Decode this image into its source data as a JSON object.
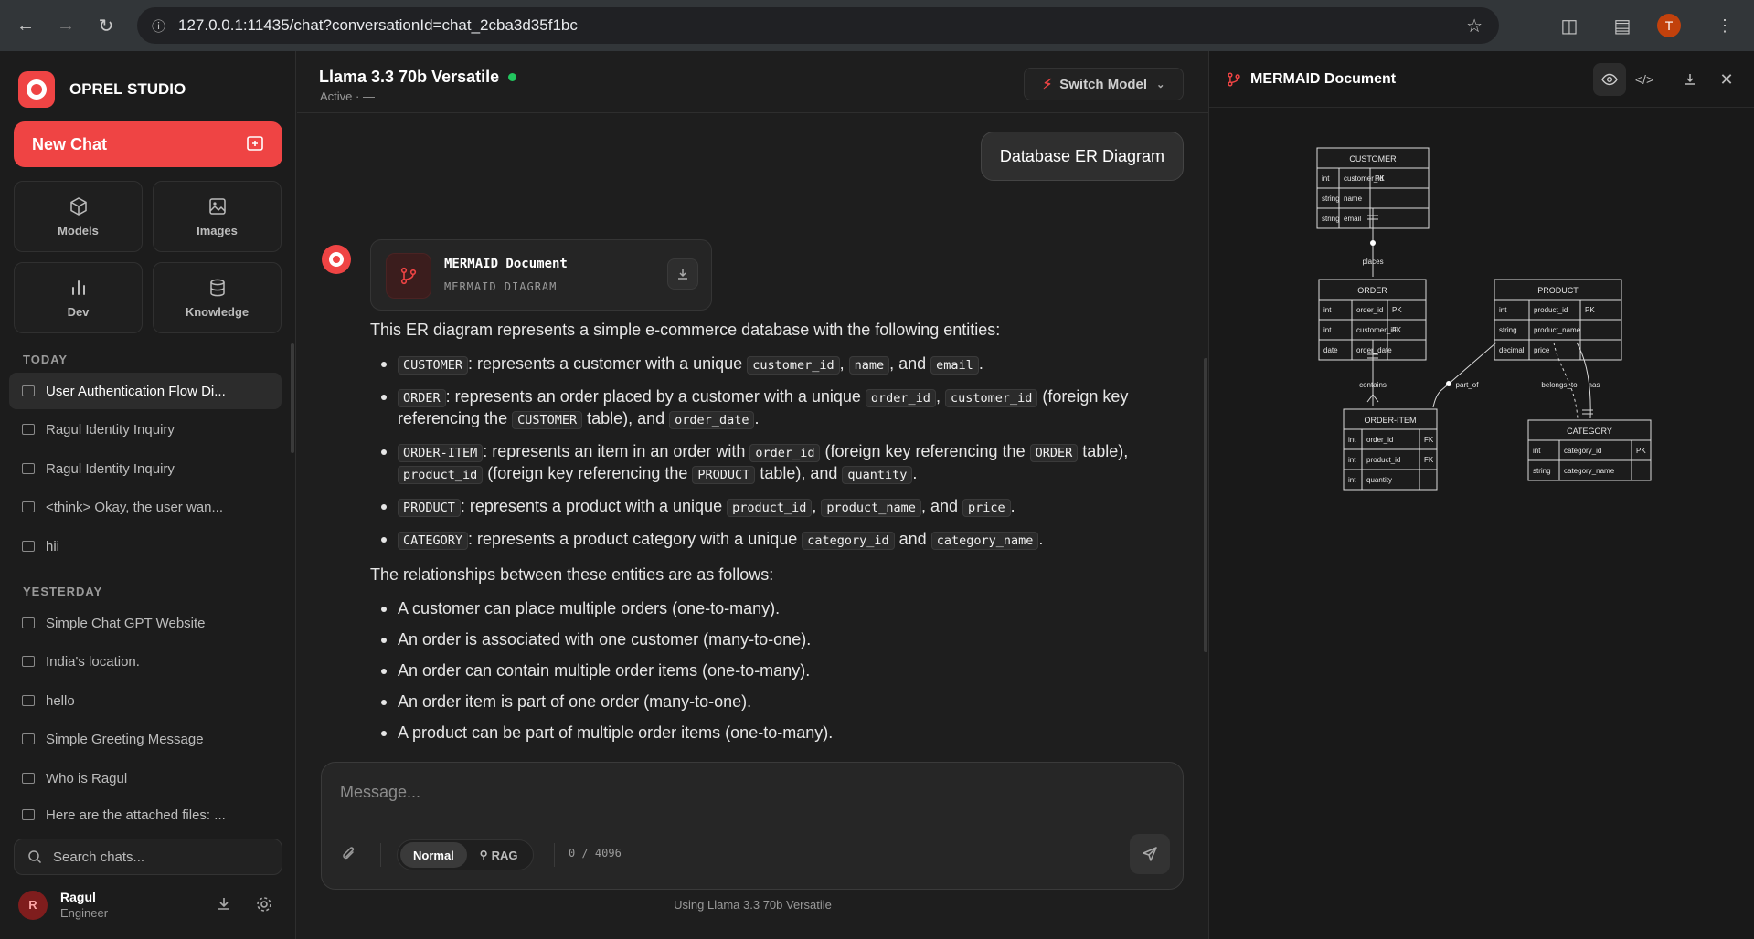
{
  "browser": {
    "url": "127.0.0.1:11435/chat?conversationId=chat_2cba3d35f1bc",
    "profile_initial": "T"
  },
  "sidebar": {
    "brand": "OPREL STUDIO",
    "new_chat": "New Chat",
    "tiles": [
      "Models",
      "Images",
      "Dev",
      "Knowledge"
    ],
    "today_label": "TODAY",
    "today": [
      "User Authentication Flow Di...",
      "Ragul Identity Inquiry",
      "Ragul Identity Inquiry",
      "<think> Okay, the user wan...",
      "hii"
    ],
    "yesterday_label": "YESTERDAY",
    "yesterday": [
      "Simple Chat GPT Website",
      "India's location.",
      "hello",
      "Simple Greeting Message",
      "Who is Ragul",
      "Here are the attached files: ..."
    ],
    "search_placeholder": "Search chats...",
    "user": {
      "initial": "R",
      "name": "Ragul",
      "role": "Engineer"
    }
  },
  "chat": {
    "model_name": "Llama 3.3 70b Versatile",
    "status": "Active · —",
    "switch_label": "Switch Model",
    "user_message": "Database ER Diagram",
    "doc_card": {
      "title": "MERMAID Document",
      "subtitle": "MERMAID DIAGRAM"
    },
    "intro": "This ER diagram represents a simple e-commerce database with the following entities:",
    "rel_intro": "The relationships between these entities are as follows:",
    "relationships": [
      "A customer can place multiple orders (one-to-many).",
      "An order is associated with one customer (many-to-one).",
      "An order can contain multiple order items (one-to-many).",
      "An order item is part of one order (many-to-one).",
      "A product can be part of multiple order items (one-to-many)."
    ],
    "entities_text": {
      "e1": {
        "code": "CUSTOMER",
        "t1": ": represents a customer with a unique ",
        "c1": "customer_id",
        "t2": ", ",
        "c2": "name",
        "t3": ", and ",
        "c3": "email",
        "t4": "."
      },
      "e2": {
        "code": "ORDER",
        "t1": ": represents an order placed by a customer with a unique ",
        "c1": "order_id",
        "t2": ", ",
        "c2": "customer_id",
        "t3": " (foreign key referencing the ",
        "c3": "CUSTOMER",
        "t4": " table), and ",
        "c4": "order_date",
        "t5": "."
      },
      "e3": {
        "code": "ORDER-ITEM",
        "t1": ": represents an item in an order with ",
        "c1": "order_id",
        "t2": " (foreign key referencing the ",
        "c2": "ORDER",
        "t3": " table), ",
        "c3": "product_id",
        "t4": " (foreign key referencing the ",
        "c4": "PRODUCT",
        "t5": " table), and ",
        "c5": "quantity",
        "t6": "."
      },
      "e4": {
        "code": "PRODUCT",
        "t1": ": represents a product with a unique ",
        "c1": "product_id",
        "t2": ", ",
        "c2": "product_name",
        "t3": ", and ",
        "c3": "price",
        "t4": "."
      },
      "e5": {
        "code": "CATEGORY",
        "t1": ": represents a product category with a unique ",
        "c1": "category_id",
        "t2": " and ",
        "c2": "category_name",
        "t3": "."
      }
    },
    "composer": {
      "placeholder": "Message...",
      "mode_normal": "Normal",
      "mode_rag": "RAG",
      "counter": "0 / 4096"
    },
    "footer": "Using Llama 3.3 70b Versatile"
  },
  "panel": {
    "title": "MERMAID Document",
    "diagram": {
      "entities": {
        "customer": {
          "name": "CUSTOMER",
          "rows": [
            [
              "int",
              "customer_id",
              "PK"
            ],
            [
              "string",
              "name",
              ""
            ],
            [
              "string",
              "email",
              ""
            ]
          ]
        },
        "order": {
          "name": "ORDER",
          "rows": [
            [
              "int",
              "order_id",
              "PK"
            ],
            [
              "int",
              "customer_id",
              "FK"
            ],
            [
              "date",
              "order_date",
              ""
            ]
          ]
        },
        "product": {
          "name": "PRODUCT",
          "rows": [
            [
              "int",
              "product_id",
              "PK"
            ],
            [
              "string",
              "product_name",
              ""
            ],
            [
              "decimal",
              "price",
              ""
            ]
          ]
        },
        "order_item": {
          "name": "ORDER-ITEM",
          "rows": [
            [
              "int",
              "order_id",
              "FK"
            ],
            [
              "int",
              "product_id",
              "FK"
            ],
            [
              "int",
              "quantity",
              ""
            ]
          ]
        },
        "category": {
          "name": "CATEGORY",
          "rows": [
            [
              "int",
              "category_id",
              "PK"
            ],
            [
              "string",
              "category_name",
              ""
            ]
          ]
        }
      },
      "labels": {
        "places": "places",
        "contains": "contains",
        "part_of": "part_of",
        "belongs_to": "belongs_to",
        "has": "has"
      }
    }
  },
  "colors": {
    "accent": "#ef4444",
    "online": "#22c55e",
    "bg": "#1e1e1e",
    "sidebar_bg": "#1c1c1c"
  }
}
